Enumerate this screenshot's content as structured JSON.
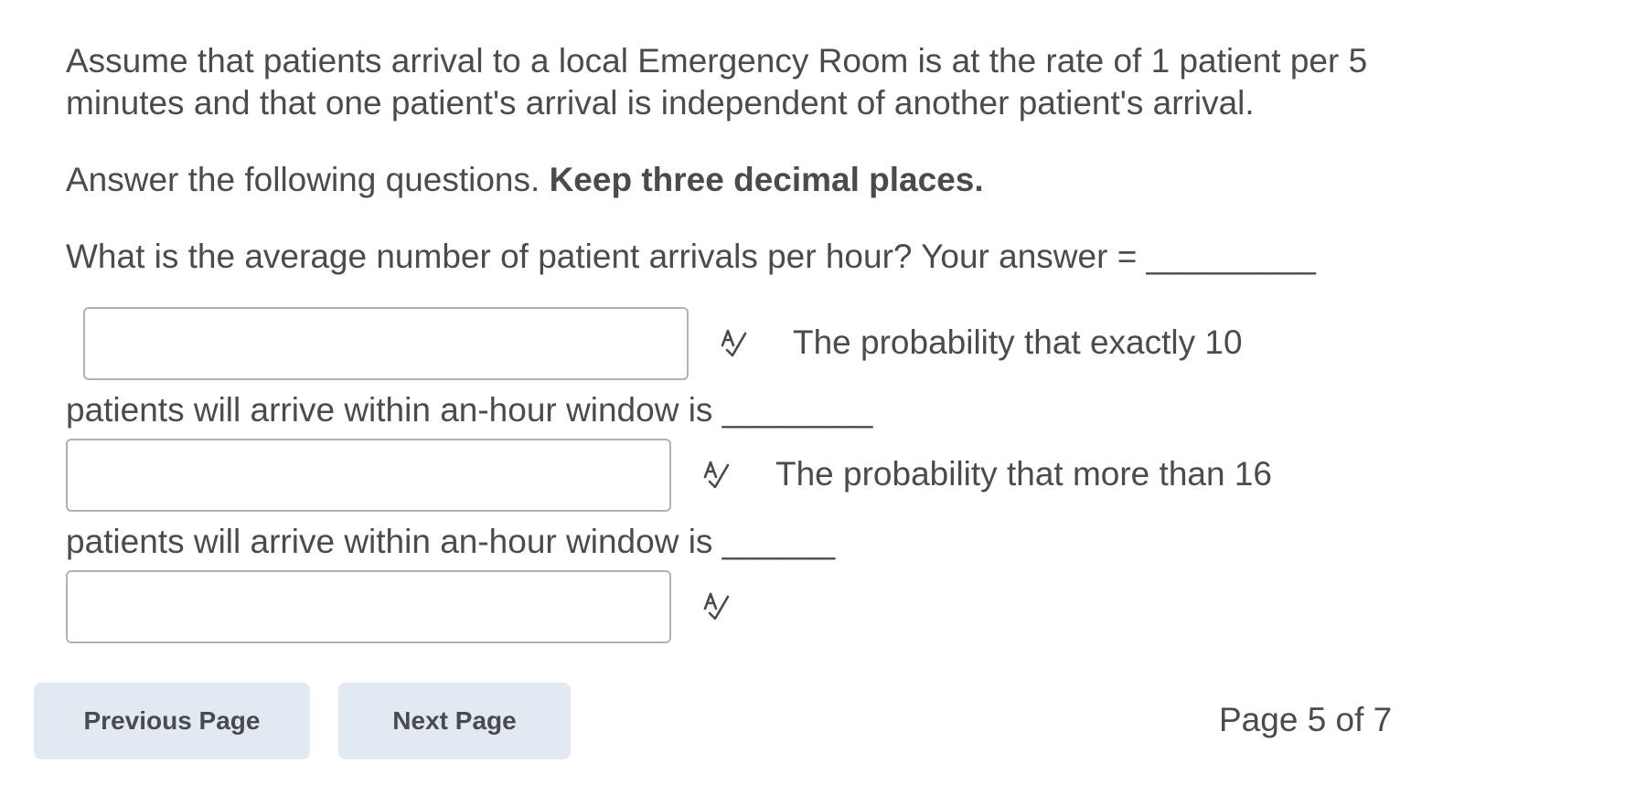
{
  "question": {
    "intro": "Assume that patients arrival to a local Emergency Room is at the rate of 1 patient per 5 minutes and that one patient's arrival is independent of another patient's arrival.",
    "instruction_plain": "Answer the following questions. ",
    "instruction_bold": "Keep three decimal places.",
    "q1": "What is the average number of patient arrivals per hour? Your answer = _________",
    "q2_start": "The probability that exactly 10",
    "q2_end": "patients will arrive within an-hour window is ________",
    "q3_start": "The probability that more than 16",
    "q3_end": "patients will arrive within an-hour window is ______"
  },
  "answers": [
    {
      "value": "",
      "spellcheck_icon": "spellcheck-icon"
    },
    {
      "value": "",
      "spellcheck_icon": "spellcheck-icon"
    },
    {
      "value": "",
      "spellcheck_icon": "spellcheck-icon"
    }
  ],
  "navigation": {
    "previous_label": "Previous Page",
    "next_label": "Next Page",
    "page_indicator": "Page 5 of 7"
  },
  "colors": {
    "text": "#494c4e",
    "button_bg": "#e3e9f1",
    "input_border": "#aeb3b6"
  }
}
